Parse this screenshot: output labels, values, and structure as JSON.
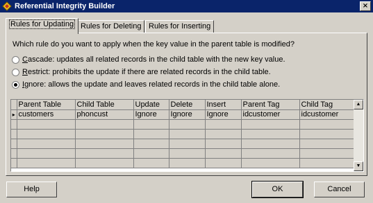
{
  "window": {
    "title": "Referential Integrity Builder",
    "close_label": "×"
  },
  "tabs": [
    {
      "label": "Rules for Updating",
      "active": true
    },
    {
      "label": "Rules for Deleting",
      "active": false
    },
    {
      "label": "Rules for Inserting",
      "active": false
    }
  ],
  "question": "Which rule do you want to apply when the key value in the parent table is modified?",
  "options": [
    {
      "key": "C",
      "rest": "ascade: updates all related records in the child table with the new key value.",
      "checked": false
    },
    {
      "key": "R",
      "rest": "estrict: prohibits the update if there are related records in the child table.",
      "checked": false
    },
    {
      "key": "I",
      "rest": "gnore: allows the update and leaves related records in the child table alone.",
      "checked": true
    }
  ],
  "grid": {
    "columns": [
      "Parent Table",
      "Child Table",
      "Update",
      "Delete",
      "Insert",
      "Parent Tag",
      "Child Tag"
    ],
    "rows": [
      {
        "marker": "▸",
        "cells": [
          "customers",
          "phoncust",
          "Ignore",
          "Ignore",
          "Ignore",
          "idcustomer",
          "idcustomer"
        ]
      }
    ],
    "empty_rows": 5
  },
  "buttons": {
    "help": "Help",
    "ok": "OK",
    "cancel": "Cancel"
  }
}
